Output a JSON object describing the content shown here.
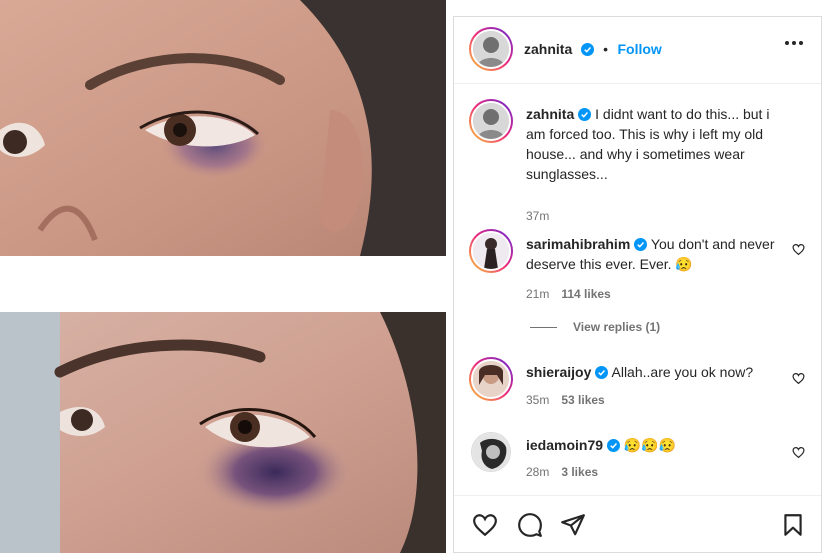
{
  "post": {
    "author": "zahnita",
    "follow_label": "Follow",
    "separator": "•"
  },
  "caption": {
    "username": "zahnita",
    "text": "I didnt want to do this... but i am forced too. This is why i left my old house... and why i sometimes wear sunglasses...",
    "time": "37m"
  },
  "comments": [
    {
      "username": "sarimahibrahim",
      "text": "You don't and never deserve this ever. Ever. 😥",
      "time": "21m",
      "likes": "114 likes"
    },
    {
      "username": "shieraijoy",
      "text": "Allah..are you ok now?",
      "time": "35m",
      "likes": "53 likes"
    },
    {
      "username": "iedamoin79",
      "text": "😥😥😥",
      "time": "28m",
      "likes": "3 likes"
    }
  ],
  "view_replies": "View replies (1)",
  "icons": {
    "like": "heart-icon",
    "comment": "comment-icon",
    "share": "send-icon",
    "save": "bookmark-icon",
    "more": "more-options-icon",
    "verified": "verified-badge-icon"
  },
  "colors": {
    "follow": "#0095f6",
    "verified": "#0095f6",
    "muted": "#737373"
  }
}
